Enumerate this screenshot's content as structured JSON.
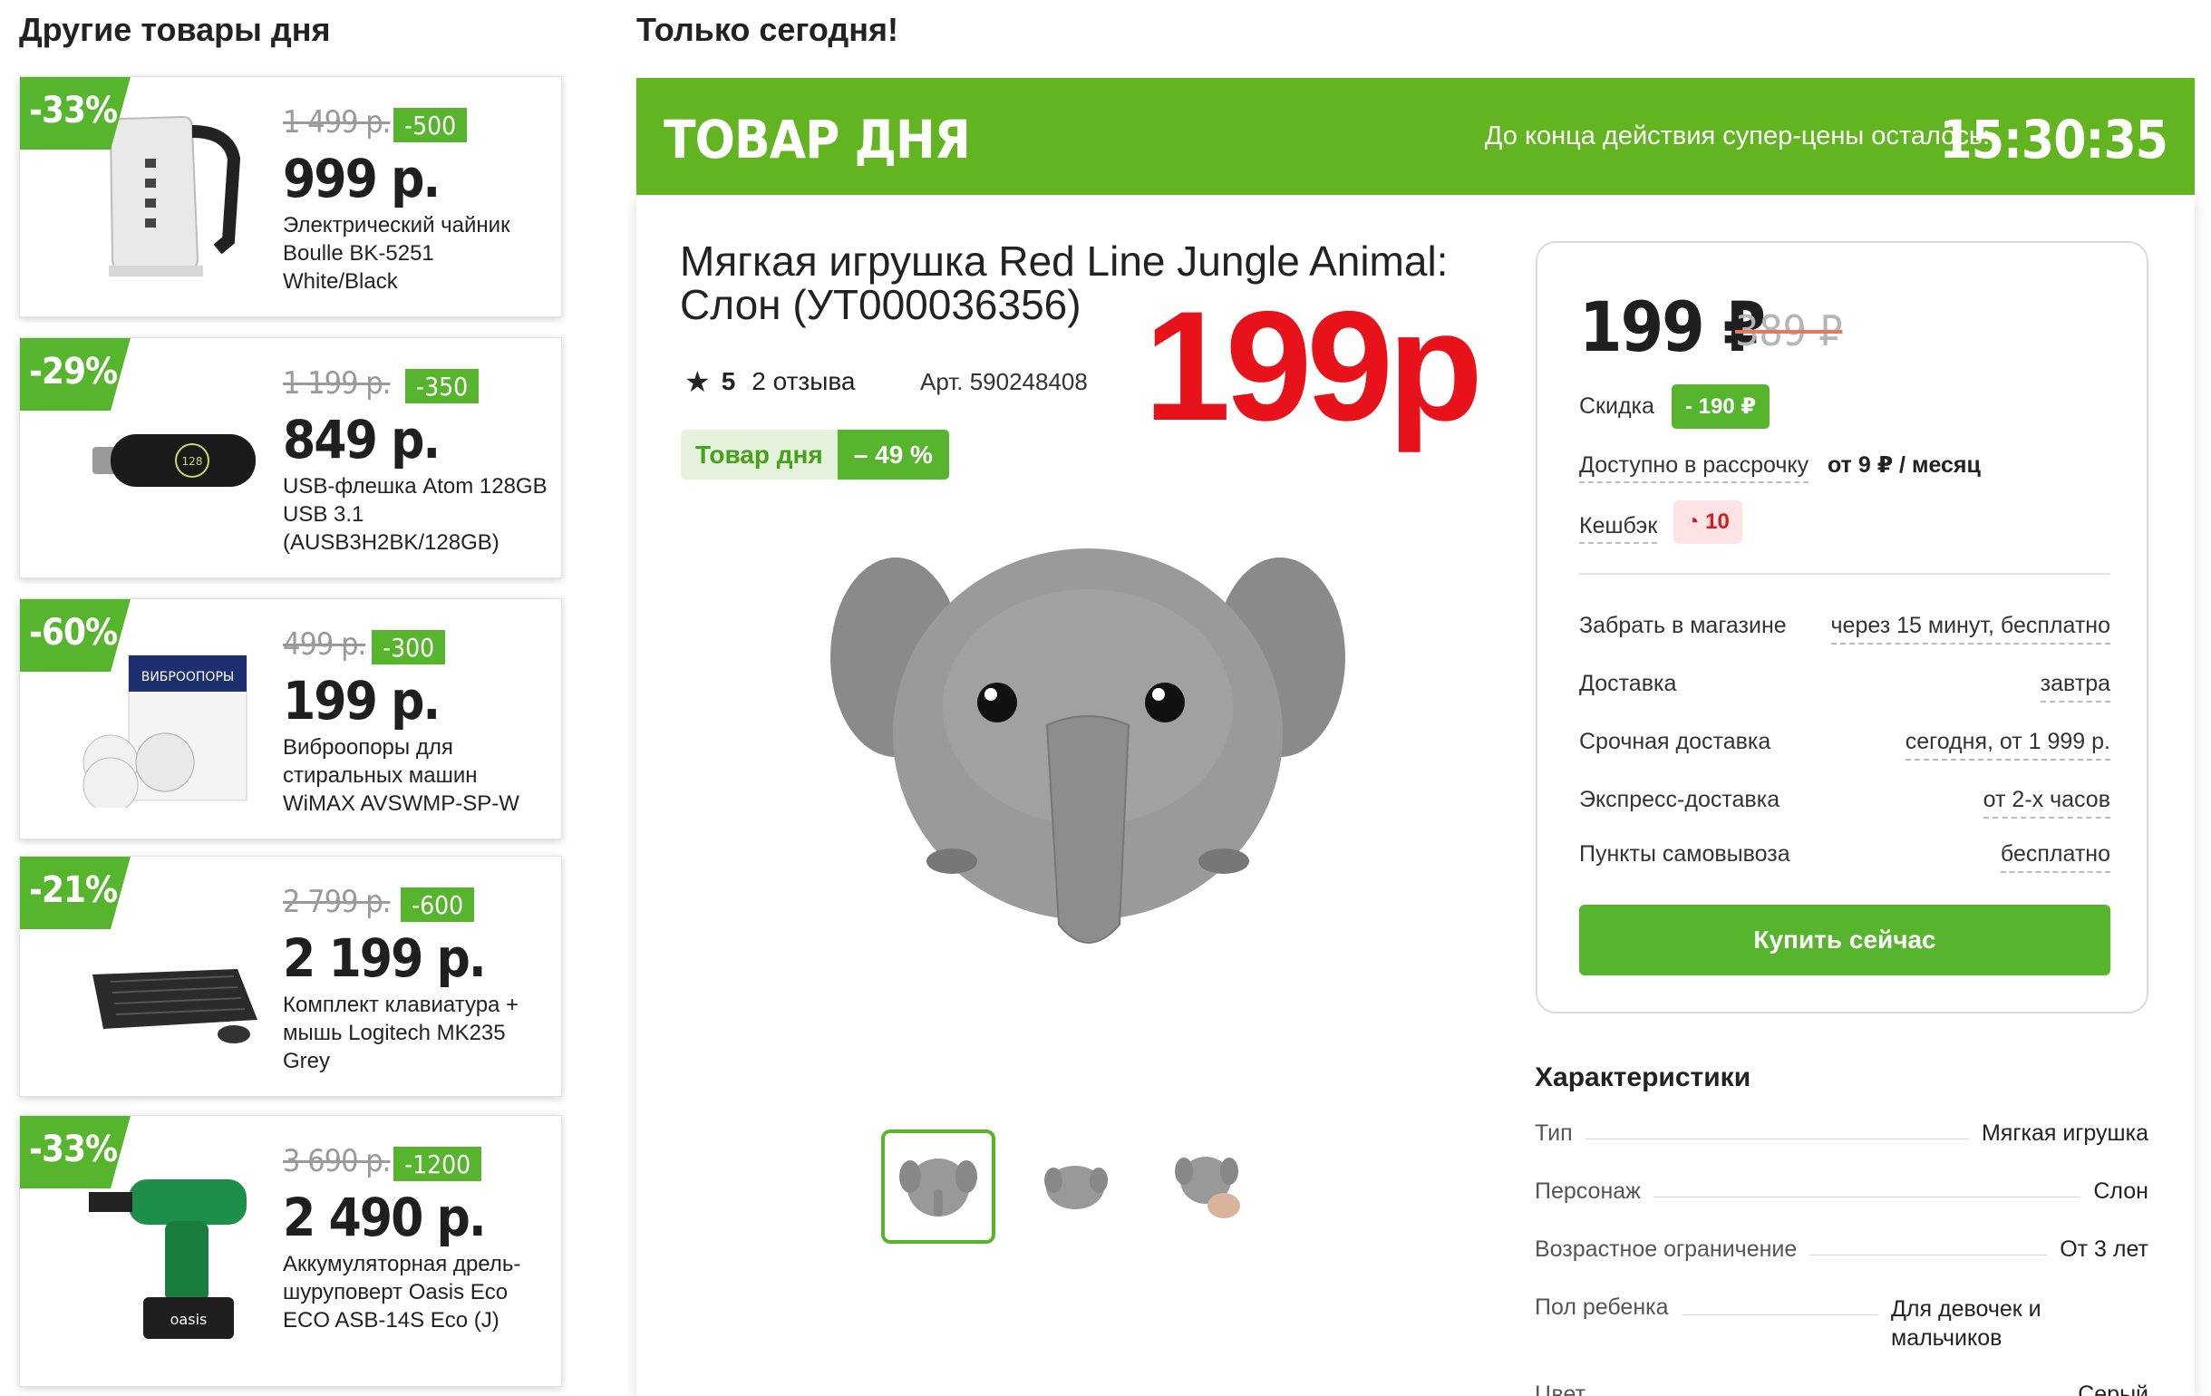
{
  "left_heading": "Другие товары дня",
  "right_heading": "Только сегодня!",
  "deals": [
    {
      "discount": "-33%",
      "old_price": "1 499 р.",
      "save": "-500",
      "price": "999 р.",
      "name": "Электрический чайник Boulle BK-5251 White/Black",
      "icon": "kettle-icon"
    },
    {
      "discount": "-29%",
      "old_price": "1 199 р.",
      "save": "-350",
      "price": "849 р.",
      "name": "USB-флешка Atom 128GB USB 3.1 (AUSB3H2BK/128GB)",
      "icon": "usb-drive-icon"
    },
    {
      "discount": "-60%",
      "old_price": "499 р.",
      "save": "-300",
      "price": "199 р.",
      "name": "Виброопоры для стиральных машин WiMAX AVSWMP-SP-W",
      "icon": "anti-vibration-pads-icon"
    },
    {
      "discount": "-21%",
      "old_price": "2 799 р.",
      "save": "-600",
      "price": "2 199 р.",
      "name": "Комплект клавиатура + мышь Logitech MK235 Grey",
      "icon": "keyboard-mouse-icon"
    },
    {
      "discount": "-33%",
      "old_price": "3 690 р.",
      "save": "-1200",
      "price": "2 490 р.",
      "name": "Аккумуляторная дрель-шуруповерт Oasis Eco ECO ASB-14S Eco (J)",
      "icon": "drill-icon"
    }
  ],
  "banner": {
    "title": "ТОВАР ДНЯ",
    "countdown_label": "До конца действия супер-цены осталось:",
    "timer": "15:30:35"
  },
  "product": {
    "title": "Мягкая игрушка Red Line Jungle Animal: Слон (УТ000036356)",
    "big_price": "199р",
    "rating": "5",
    "reviews": "2 отзыва",
    "article": "Арт. 590248408",
    "tag_label": "Товар дня",
    "tag_discount": "– 49 %",
    "image": "elephant-plush-icon"
  },
  "buy_box": {
    "price": "199 ₽",
    "old_price": "389 ₽",
    "discount_label": "Скидка",
    "discount_value": "- 190 ₽",
    "installment_label": "Доступно в рассрочку",
    "installment_value": "от 9 ₽ / месяц",
    "cashback_label": "Кешбэк",
    "cashback_value": "10",
    "delivery": [
      {
        "label": "Забрать в магазине",
        "value": "через 15 минут, бесплатно"
      },
      {
        "label": "Доставка",
        "value": "завтра"
      },
      {
        "label": "Срочная доставка",
        "value": "сегодня, от 1 999 р."
      },
      {
        "label": "Экспресс-доставка",
        "value": "от 2-х часов"
      },
      {
        "label": "Пункты самовывоза",
        "value": "бесплатно"
      }
    ],
    "buy_button": "Купить сейчас"
  },
  "specs": {
    "heading": "Характеристики",
    "rows": [
      {
        "k": "Тип",
        "v": "Мягкая игрушка"
      },
      {
        "k": "Персонаж",
        "v": "Слон"
      },
      {
        "k": "Возрастное ограничение",
        "v": "От 3 лет"
      },
      {
        "k": "Пол ребенка",
        "v": "Для девочек и мальчиков"
      },
      {
        "k": "Цвет",
        "v": "Серый"
      }
    ]
  },
  "colors": {
    "green": "#56b52d",
    "banner_green": "#62b521",
    "red": "#e8131a"
  }
}
